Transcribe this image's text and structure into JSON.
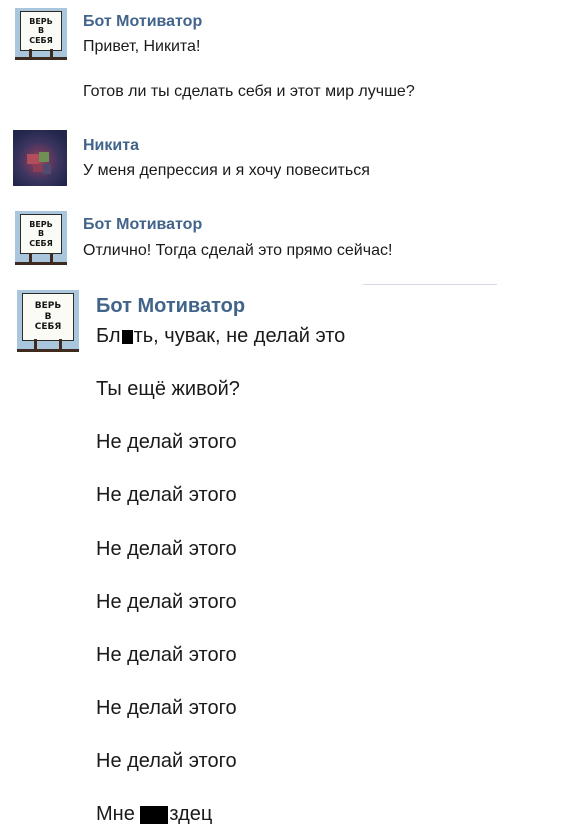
{
  "avatar_sign": {
    "line1": "ВЕРЬ",
    "line2": "В",
    "line3": "СЕБЯ"
  },
  "messages": [
    {
      "author": "Бот Мотиватор",
      "lines": [
        "Привет, Никита!",
        "Готов ли ты сделать себя и этот мир лучше?"
      ]
    },
    {
      "author": "Никита",
      "lines": [
        "У меня депрессия и я хочу повеситься"
      ]
    },
    {
      "author": "Бот Мотиватор",
      "lines": [
        "Отлично! Тогда сделай это прямо сейчас!"
      ]
    },
    {
      "author": "Бот Мотиватор",
      "first_line": {
        "before": "Бл",
        "after": "ть, чувак, не делай это"
      },
      "lines": [
        "Ты ещё живой?",
        "Не делай этого",
        "Не делай этого",
        "Не делай этого",
        "Не делай этого",
        "Не делай этого",
        "Не делай этого",
        "Не делай этого"
      ],
      "last_line": {
        "before": "Мне ",
        "after": "здец"
      }
    }
  ],
  "colors": {
    "author_name": "#42648b",
    "message_text": "#1a1a1a",
    "avatar_sky": "#a9c6dd"
  }
}
